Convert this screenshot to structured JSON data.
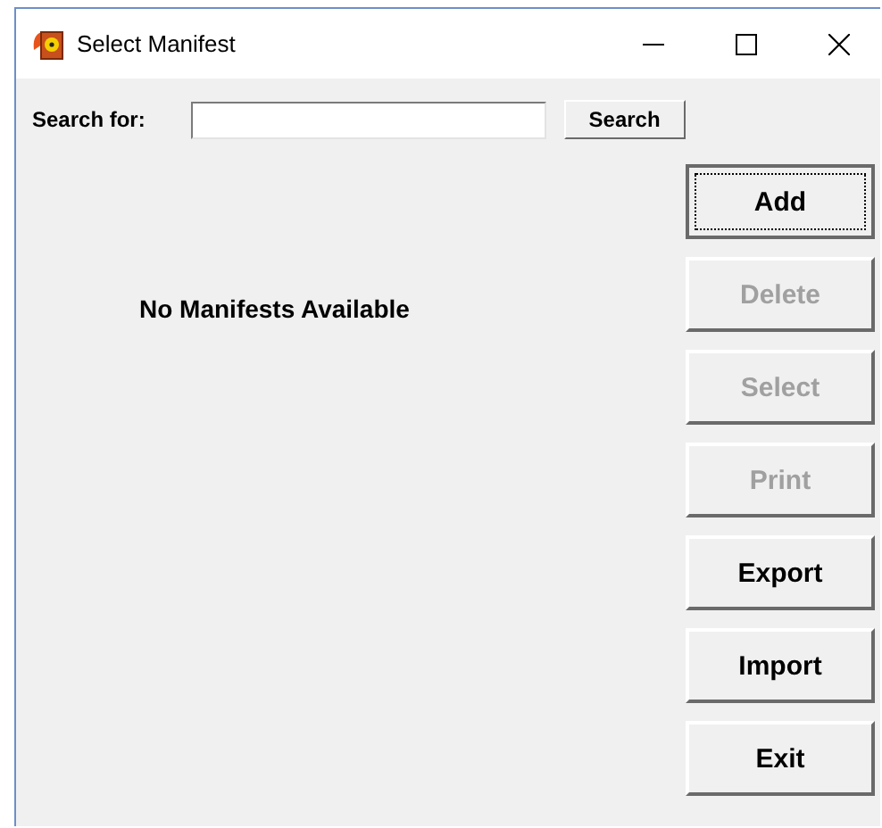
{
  "window": {
    "title": "Select Manifest"
  },
  "search": {
    "label": "Search for:",
    "button": "Search"
  },
  "message": "No Manifests Available",
  "buttons": [
    {
      "label": "Add",
      "disabled": false,
      "focused": true
    },
    {
      "label": "Delete",
      "disabled": true,
      "focused": false
    },
    {
      "label": "Select",
      "disabled": true,
      "focused": false
    },
    {
      "label": "Print",
      "disabled": true,
      "focused": false
    },
    {
      "label": "Export",
      "disabled": false,
      "focused": false
    },
    {
      "label": "Import",
      "disabled": false,
      "focused": false
    },
    {
      "label": "Exit",
      "disabled": false,
      "focused": false
    }
  ]
}
